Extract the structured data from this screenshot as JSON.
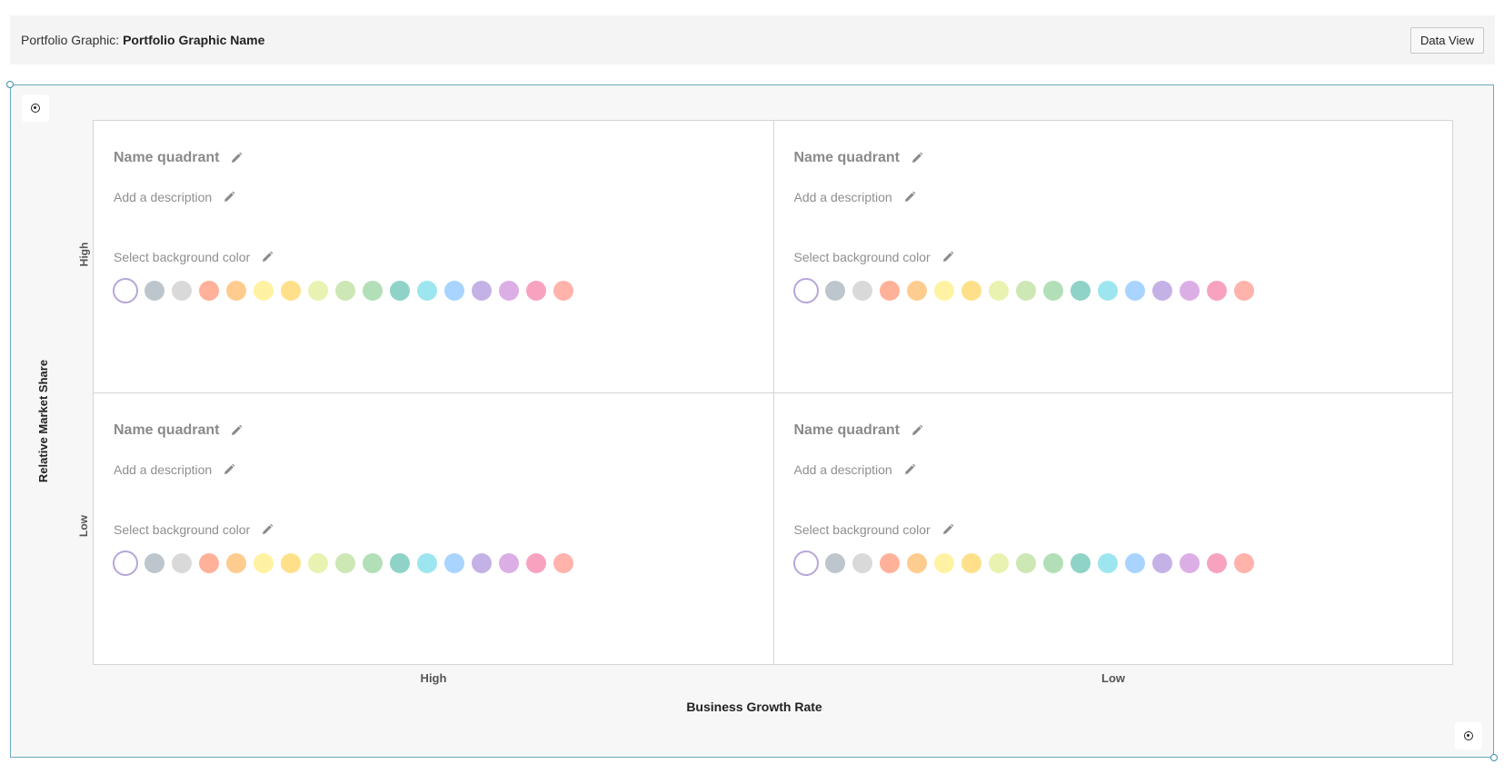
{
  "header": {
    "prefix": "Portfolio Graphic:",
    "name": "Portfolio Graphic Name",
    "data_view_label": "Data View"
  },
  "axes": {
    "y_title": "Relative Market Share",
    "y_high": "High",
    "y_low": "Low",
    "x_high": "High",
    "x_low": "Low",
    "x_title": "Business Growth Rate"
  },
  "icons": {
    "anchor": "target-icon",
    "edit": "pencil-icon"
  },
  "quadrants": [
    {
      "title": "Name quadrant",
      "description": "Add a description",
      "color_label": "Select background color",
      "selected_color": "#ffffff"
    },
    {
      "title": "Name quadrant",
      "description": "Add a description",
      "color_label": "Select background color",
      "selected_color": "#ffffff"
    },
    {
      "title": "Name quadrant",
      "description": "Add a description",
      "color_label": "Select background color",
      "selected_color": "#ffffff"
    },
    {
      "title": "Name quadrant",
      "description": "Add a description",
      "color_label": "Select background color",
      "selected_color": "#ffffff"
    }
  ],
  "palette": [
    "#ffffff",
    "#bcc6cc",
    "#d9d9d9",
    "#ffb199",
    "#ffcc8f",
    "#fff3a3",
    "#ffe08a",
    "#e9f2b0",
    "#cde7b5",
    "#b2dfb7",
    "#8fd3c7",
    "#9ee6ef",
    "#a8d4ff",
    "#c4b2e6",
    "#dcaee6",
    "#f7a3c0",
    "#ffb3ab"
  ],
  "colors": {
    "canvas_border": "#69a9bd",
    "header_bg": "#f4f4f4",
    "selected_ring": "#b7a6d9"
  }
}
